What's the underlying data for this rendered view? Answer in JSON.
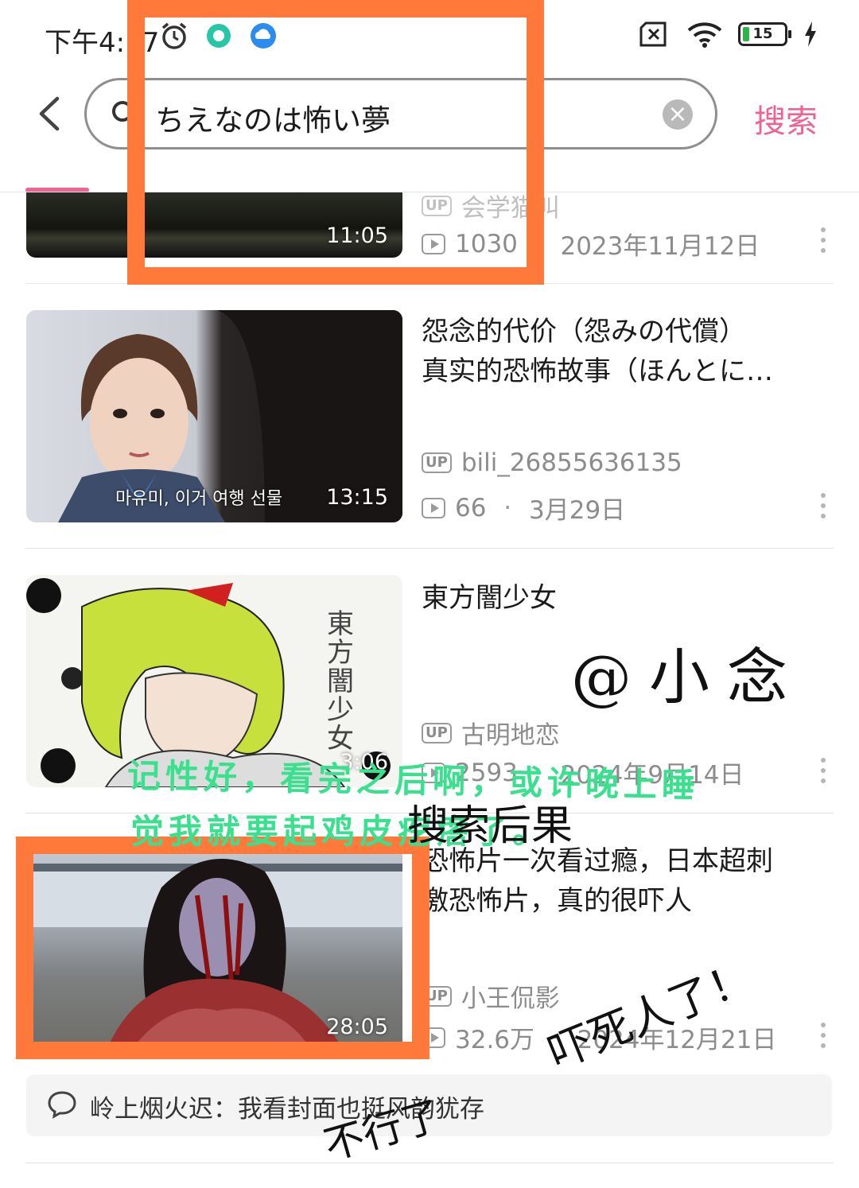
{
  "status_bar": {
    "time": "下午4:17",
    "battery_level": "15",
    "battery_color": "#2fb34a"
  },
  "header": {
    "query": "ちえなのは怖い夢",
    "clear_label": "×",
    "search_label": "搜索",
    "accent_color": "#f06292"
  },
  "results": [
    {
      "title": "",
      "uploader": "会学猫叫",
      "views": "1030",
      "date": "2023年11月12日",
      "duration": "11:05"
    },
    {
      "title_line1": "怨念的代价（怨みの代償）",
      "title_line2": "真实的恐怖故事（ほんとに…",
      "uploader": "bili_26855636135",
      "views": "66",
      "date": "3月29日",
      "duration": "13:15",
      "subtitle_caption": "마유미, 이거 여행 선물"
    },
    {
      "title": "東方闇少女",
      "uploader": "古明地恋",
      "views": "2593",
      "date": "2024年9月14日",
      "duration": "3:06",
      "thumb_text": "東方闇少女"
    },
    {
      "title_line1": "恐怖片一次看过瘾，日本超刺",
      "title_line2": "激恐怖片，真的很吓人",
      "uploader": "小王侃影",
      "views": "32.6万",
      "date": "2024年12月21日",
      "duration": "28:05"
    }
  ],
  "comment": {
    "text": "岭上烟火迟：我看封面也挺风韵犹存"
  },
  "annotations": {
    "handle": "@小念",
    "green_line1": "记性好，看完之后啊，或许晚上睡",
    "green_line2": "觉我就要起鸡皮疙瘩了。",
    "search_result_note": "搜索后果",
    "scared_note": "吓死人了！",
    "cant_note": "不行了",
    "box_color": "#ff7a3a",
    "green_color": "#3be08f"
  }
}
